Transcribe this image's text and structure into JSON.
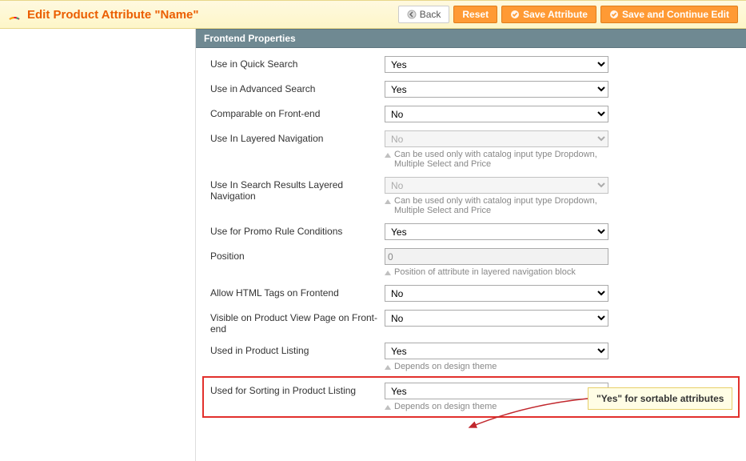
{
  "header": {
    "title": "Edit Product Attribute \"Name\"",
    "back": "Back",
    "reset": "Reset",
    "save": "Save Attribute",
    "save_continue": "Save and Continue Edit"
  },
  "section": {
    "title": "Frontend Properties"
  },
  "fields": {
    "quick_search": {
      "label": "Use in Quick Search",
      "value": "Yes"
    },
    "advanced_search": {
      "label": "Use in Advanced Search",
      "value": "Yes"
    },
    "comparable": {
      "label": "Comparable on Front-end",
      "value": "No"
    },
    "layered_nav": {
      "label": "Use In Layered Navigation",
      "value": "No",
      "hint": "Can be used only with catalog input type Dropdown, Multiple Select and Price"
    },
    "layered_nav_search": {
      "label": "Use In Search Results Layered Navigation",
      "value": "No",
      "hint": "Can be used only with catalog input type Dropdown, Multiple Select and Price"
    },
    "promo_rule": {
      "label": "Use for Promo Rule Conditions",
      "value": "Yes"
    },
    "position": {
      "label": "Position",
      "value": "0",
      "hint": "Position of attribute in layered navigation block"
    },
    "allow_html": {
      "label": "Allow HTML Tags on Frontend",
      "value": "No"
    },
    "visible_pvp": {
      "label": "Visible on Product View Page on Front-end",
      "value": "No"
    },
    "product_listing": {
      "label": "Used in Product Listing",
      "value": "Yes",
      "hint": "Depends on design theme"
    },
    "sorting_listing": {
      "label": "Used for Sorting in Product Listing",
      "value": "Yes",
      "hint": "Depends on design theme"
    }
  },
  "callout": {
    "text": "\"Yes\" for sortable attributes"
  }
}
